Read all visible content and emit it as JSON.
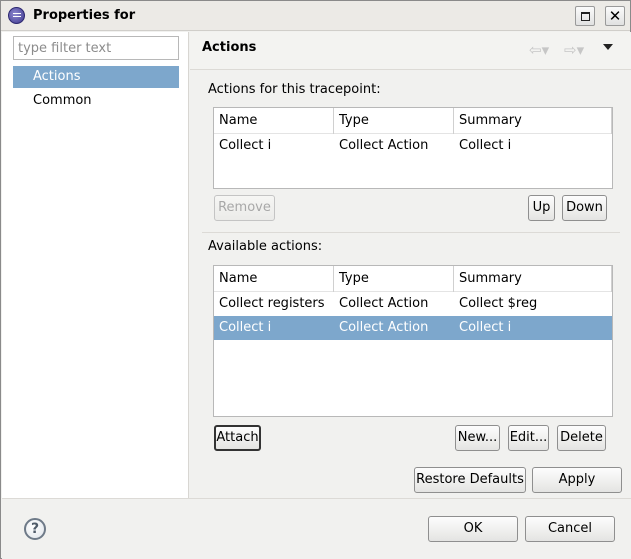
{
  "window": {
    "title": "Properties for",
    "maximize_glyph": "",
    "close_glyph": "✕"
  },
  "sidebar": {
    "filter_placeholder": "type filter text",
    "items": [
      {
        "label": "Actions",
        "selected": true
      },
      {
        "label": "Common",
        "selected": false
      }
    ]
  },
  "page": {
    "title": "Actions",
    "back_icon": "⇦▾",
    "forward_icon": "⇨▾"
  },
  "tracepoint_actions": {
    "label": "Actions for this tracepoint:",
    "columns": [
      "Name",
      "Type",
      "Summary"
    ],
    "rows": [
      {
        "name": "Collect i",
        "type": "Collect Action",
        "summary": "Collect i"
      }
    ],
    "buttons": {
      "remove": "Remove",
      "up": "Up",
      "down": "Down"
    }
  },
  "available_actions": {
    "label": "Available actions:",
    "columns": [
      "Name",
      "Type",
      "Summary"
    ],
    "rows": [
      {
        "name": "Collect registers",
        "type": "Collect Action",
        "summary": "Collect $reg"
      },
      {
        "name": "Collect i",
        "type": "Collect Action",
        "summary": "Collect i",
        "selected": true
      }
    ],
    "buttons": {
      "attach": "Attach",
      "new": "New...",
      "edit": "Edit...",
      "delete": "Delete"
    }
  },
  "page_buttons": {
    "restore_defaults": "Restore Defaults",
    "apply": "Apply"
  },
  "dialog_buttons": {
    "ok": "OK",
    "cancel": "Cancel",
    "help_glyph": "?"
  },
  "colors": {
    "selection": "#7da7cc",
    "background": "#f1f1ef"
  }
}
